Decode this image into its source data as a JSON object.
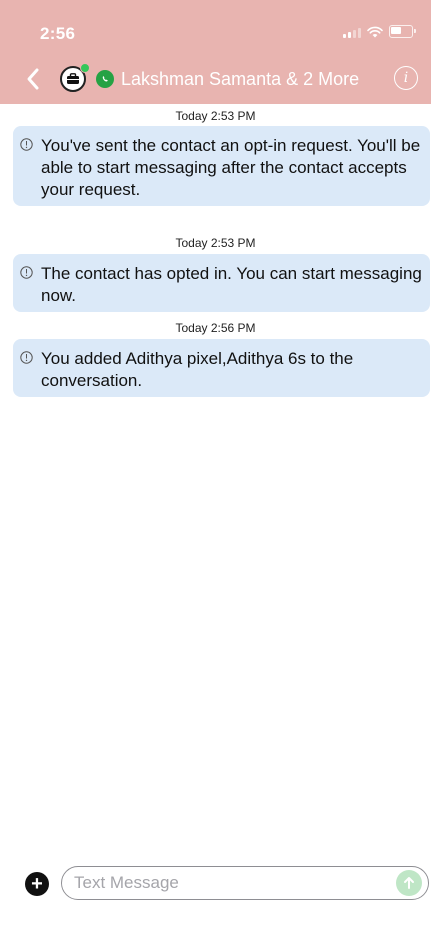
{
  "status_bar": {
    "time": "2:56"
  },
  "nav": {
    "title": "Lakshman Samanta & 2 More"
  },
  "messages": [
    {
      "timestamp": "Today 2:53 PM",
      "text": "You've sent the contact an opt-in request. You'll be able to start messaging after the contact accepts your request."
    },
    {
      "timestamp": "Today 2:53 PM",
      "text": "The contact has opted in. You can start messaging now."
    },
    {
      "timestamp": "Today 2:56 PM",
      "text": "You added Adithya pixel,Adithya 6s to the conversation."
    }
  ],
  "composer": {
    "placeholder": "Text Message"
  },
  "colors": {
    "header": "#e8b4b0",
    "bubble": "#dbe9f8",
    "whatsapp": "#25a244",
    "send": "#bfe6c6"
  }
}
